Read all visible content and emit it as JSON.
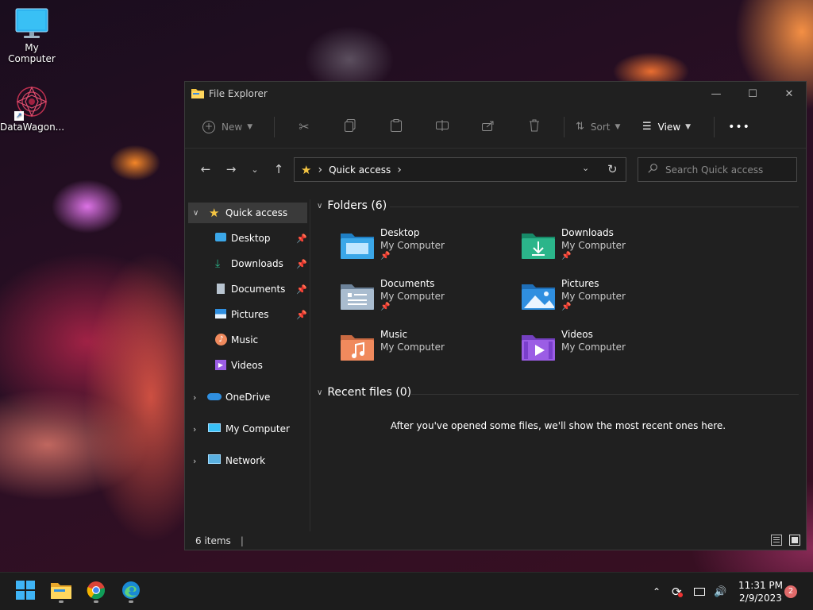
{
  "desktop": {
    "icons": [
      {
        "label": "My Computer"
      },
      {
        "label": "DataWagon..."
      }
    ]
  },
  "window": {
    "title": "File Explorer",
    "controls": {
      "minimize": "—",
      "maximize": "☐",
      "close": "✕"
    }
  },
  "toolbar": {
    "new_label": "New",
    "sort_label": "Sort",
    "view_label": "View",
    "more_label": "•••"
  },
  "address": {
    "crumb_sep": "›",
    "location": "Quick access",
    "trail_sep": "›"
  },
  "search": {
    "placeholder": "Search Quick access"
  },
  "nav": {
    "quick_access": "Quick access",
    "pinned": [
      {
        "label": "Desktop",
        "pinned": true
      },
      {
        "label": "Downloads",
        "pinned": true
      },
      {
        "label": "Documents",
        "pinned": true
      },
      {
        "label": "Pictures",
        "pinned": true
      },
      {
        "label": "Music",
        "pinned": false
      },
      {
        "label": "Videos",
        "pinned": false
      }
    ],
    "onedrive": "OneDrive",
    "my_computer": "My Computer",
    "network": "Network"
  },
  "folders_section": {
    "title": "Folders (6)",
    "items": [
      {
        "name": "Desktop",
        "location": "My Computer",
        "pinned": true,
        "color": "#3ba7e8"
      },
      {
        "name": "Downloads",
        "location": "My Computer",
        "pinned": true,
        "color": "#2bb58a"
      },
      {
        "name": "Documents",
        "location": "My Computer",
        "pinned": true,
        "color": "#8fa6bd"
      },
      {
        "name": "Pictures",
        "location": "My Computer",
        "pinned": true,
        "color": "#2f8fe0"
      },
      {
        "name": "Music",
        "location": "My Computer",
        "pinned": false,
        "color": "#f08a5d"
      },
      {
        "name": "Videos",
        "location": "My Computer",
        "pinned": false,
        "color": "#9b5de5"
      }
    ]
  },
  "recent_section": {
    "title": "Recent files (0)",
    "empty_message": "After you've opened some files, we'll show the most recent ones here."
  },
  "status": {
    "items_count": "6 items",
    "separator": "|"
  },
  "taskbar": {
    "clock_time": "11:31 PM",
    "clock_date": "2/9/2023",
    "notification_count": "2"
  },
  "colors": {
    "window_bg": "#202020",
    "selection": "#3a3a3a",
    "accent": "#0078d4"
  }
}
